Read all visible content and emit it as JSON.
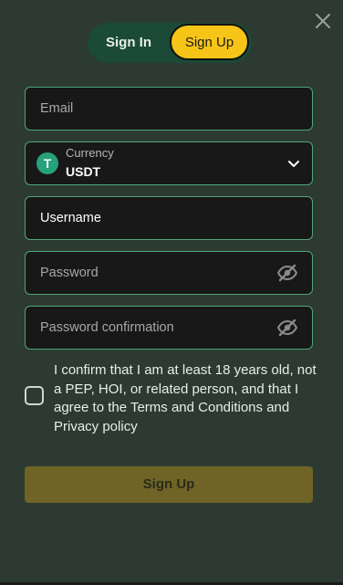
{
  "tabs": {
    "sign_in": "Sign In",
    "sign_up": "Sign Up",
    "active": "sign_up"
  },
  "form": {
    "email": {
      "placeholder": "Email",
      "value": ""
    },
    "currency": {
      "label": "Currency",
      "value": "USDT",
      "icon": "tether-icon",
      "icon_glyph": "T"
    },
    "username": {
      "placeholder": "Username",
      "value": "Username"
    },
    "password": {
      "placeholder": "Password",
      "value": ""
    },
    "password_confirmation": {
      "placeholder": "Password confirmation",
      "value": ""
    },
    "terms_text": "I confirm that I am at least 18 years old, not a PEP, HOI, or related person, and that I agree to the Terms and Conditions and Privacy policy",
    "terms_checked": false,
    "submit_label": "Sign Up"
  },
  "colors": {
    "background": "#2c3a31",
    "accent": "#f6c518",
    "field_border": "#4fa67a",
    "tabs_bg": "#1b4a36",
    "tether": "#26a17b",
    "submit_disabled": "#6f6426"
  }
}
